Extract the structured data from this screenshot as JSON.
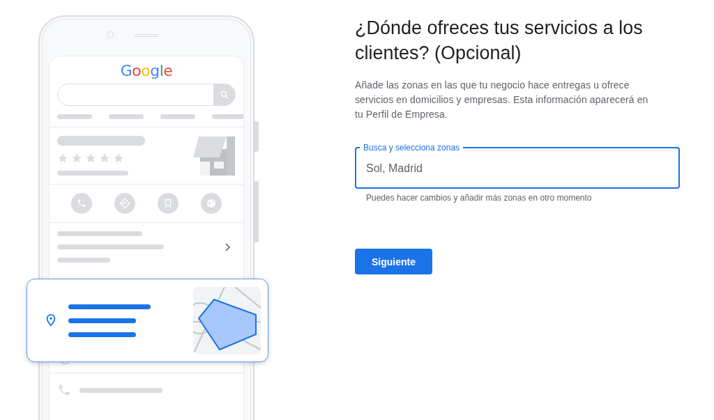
{
  "illustration": {
    "logo": "Google"
  },
  "heading": "¿Dónde ofreces tus servicios a los clientes? (Opcional)",
  "description": "Añade las zonas en las que tu negocio hace entregas u ofrece servicios en domicilios y empresas. Esta información aparecerá en tu Perfil de Empresa.",
  "area_field": {
    "label": "Busca y selecciona zonas",
    "placeholder": "Sol, Madrid",
    "focused": true,
    "helper": "Puedes hacer cambios y añadir más zonas en otro momento"
  },
  "next_button": "Siguiente"
}
